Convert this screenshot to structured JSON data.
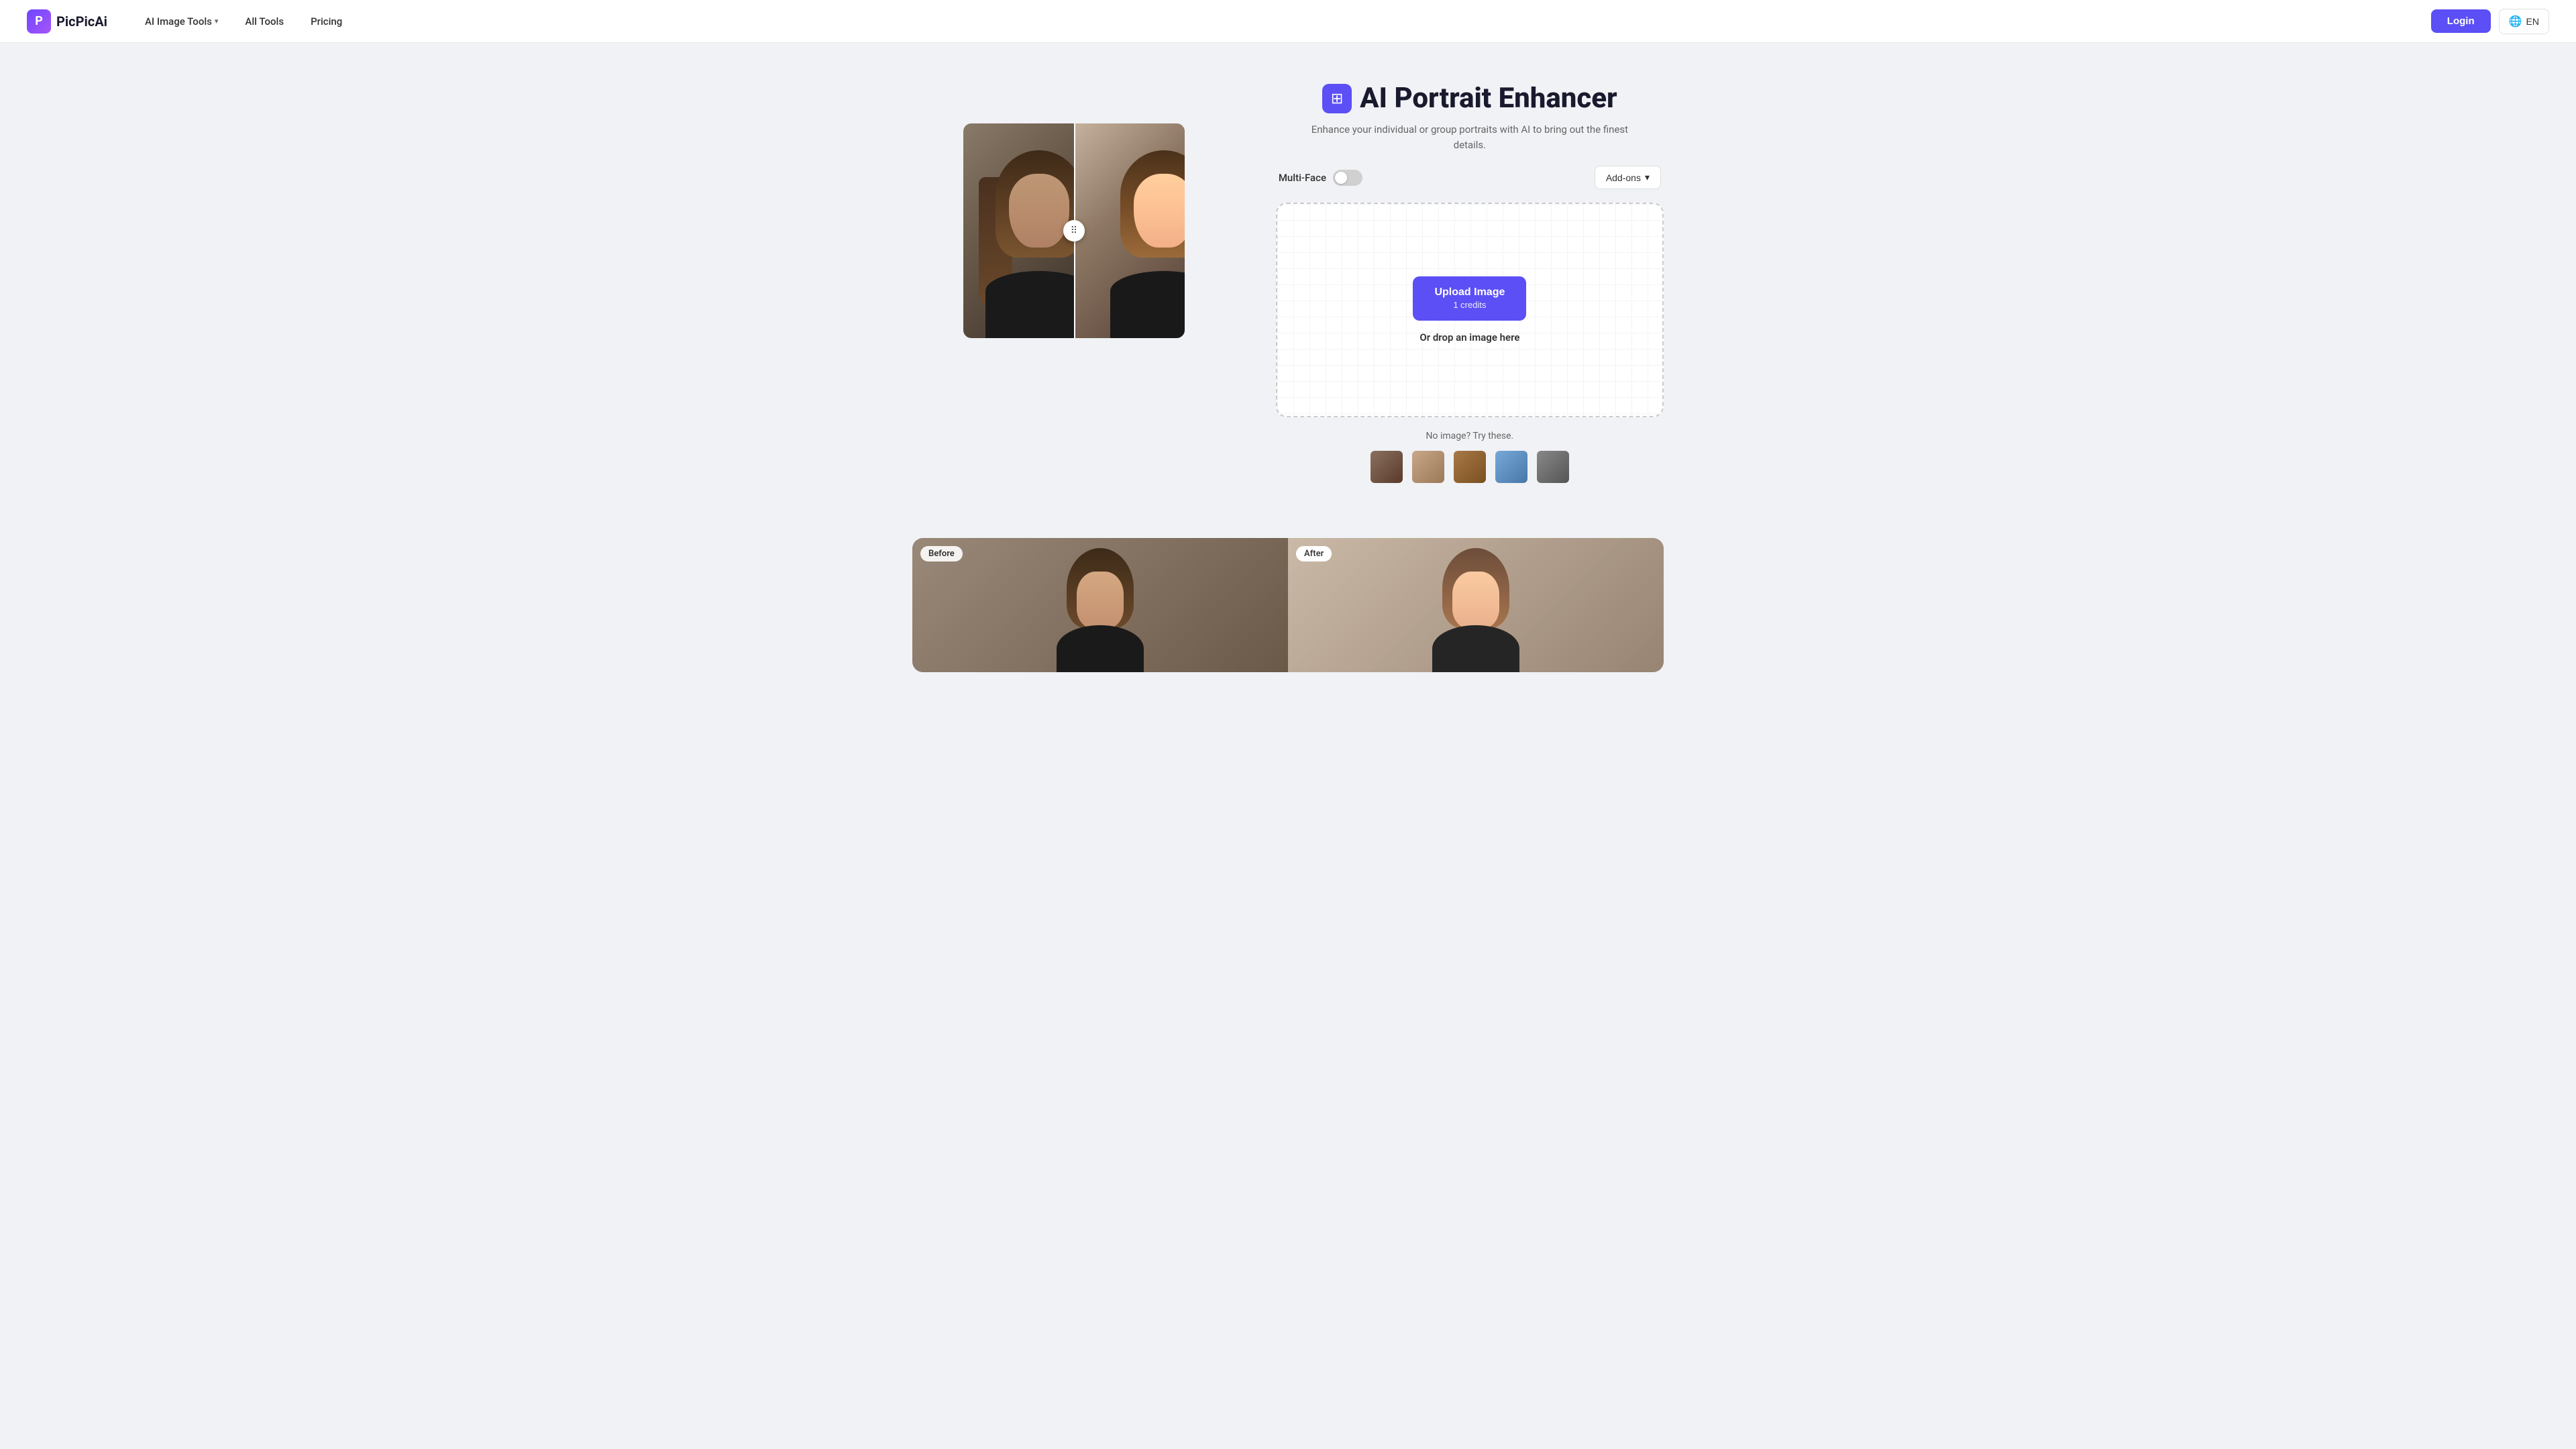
{
  "nav": {
    "logo_text": "PicPicAi",
    "logo_icon": "P",
    "links": [
      {
        "id": "ai-image-tools",
        "label": "AI Image Tools",
        "has_chevron": true
      },
      {
        "id": "all-tools",
        "label": "All Tools",
        "has_chevron": false
      },
      {
        "id": "pricing",
        "label": "Pricing",
        "has_chevron": false
      }
    ],
    "login_label": "Login",
    "lang_label": "EN"
  },
  "tool": {
    "icon_symbol": "⊞",
    "title": "AI Portrait Enhancer",
    "subtitle": "Enhance your individual or group portraits with AI to bring out the finest details.",
    "multi_face_label": "Multi-Face",
    "addons_label": "Add-ons",
    "upload_button_label": "Upload Image",
    "upload_credits": "1 credits",
    "drop_text": "Or drop an image here",
    "sample_label": "No image? Try these.",
    "sample_thumbs": [
      {
        "id": "thumb-1",
        "alt": "Portrait sample 1"
      },
      {
        "id": "thumb-2",
        "alt": "Portrait sample 2"
      },
      {
        "id": "thumb-3",
        "alt": "Portrait sample 3"
      },
      {
        "id": "thumb-4",
        "alt": "Portrait sample 4"
      },
      {
        "id": "thumb-5",
        "alt": "Portrait sample 5"
      }
    ]
  },
  "bottom_preview": {
    "before_label": "Before",
    "after_label": "After"
  },
  "colors": {
    "primary": "#5b4ff5",
    "primary_dark": "#4a3fd4",
    "text_dark": "#1a1a2e",
    "text_mid": "#666",
    "bg": "#f0f2f5"
  }
}
